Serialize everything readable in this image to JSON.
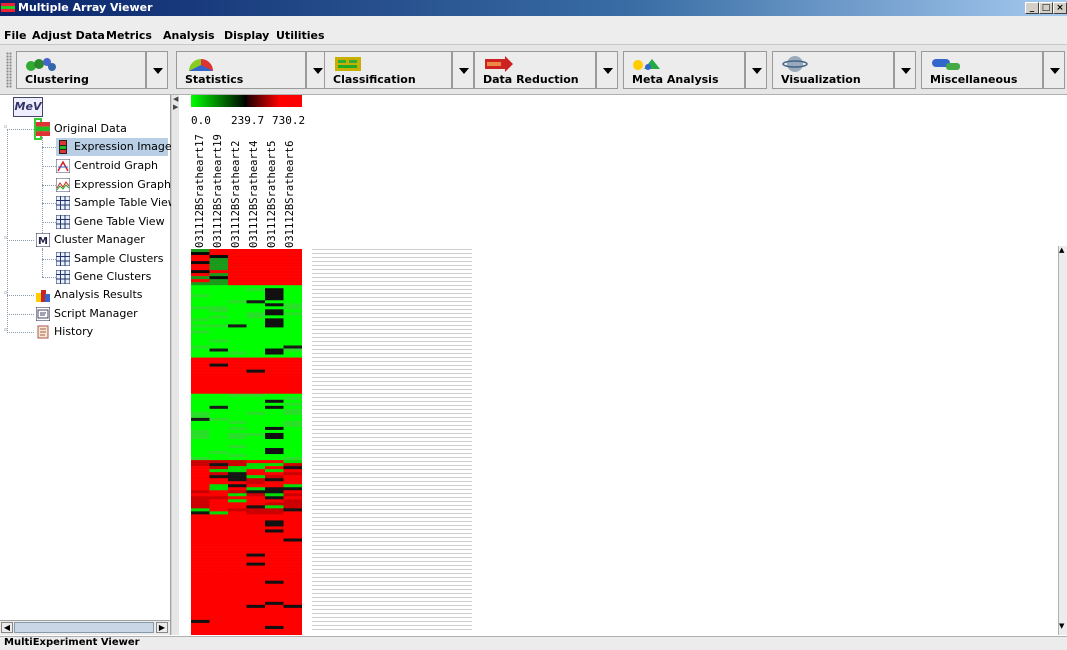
{
  "window": {
    "title": "Multiple Array Viewer"
  },
  "menu": [
    "File",
    "Adjust Data",
    "Metrics",
    "Analysis",
    "Display",
    "Utilities"
  ],
  "toolbar": [
    {
      "label": "Clustering",
      "icon": "clustering-icon"
    },
    {
      "label": "Statistics",
      "icon": "statistics-icon"
    },
    {
      "label": "Classification",
      "icon": "classification-icon"
    },
    {
      "label": "Data Reduction",
      "icon": "data-reduction-icon"
    },
    {
      "label": "Meta Analysis",
      "icon": "meta-analysis-icon"
    },
    {
      "label": "Visualization",
      "icon": "visualization-icon"
    },
    {
      "label": "Miscellaneous",
      "icon": "miscellaneous-icon"
    }
  ],
  "tree": {
    "logo": "MeV",
    "items": [
      {
        "label": "Original Data",
        "icon": "original-data-icon"
      },
      {
        "label": "Expression Image",
        "icon": "expression-image-icon"
      },
      {
        "label": "Centroid Graph",
        "icon": "centroid-graph-icon"
      },
      {
        "label": "Expression Graph",
        "icon": "expression-graph-icon"
      },
      {
        "label": "Sample Table View",
        "icon": "table-icon"
      },
      {
        "label": "Gene Table View",
        "icon": "table-icon"
      },
      {
        "label": "Cluster Manager",
        "icon": "cluster-manager-icon"
      },
      {
        "label": "Sample Clusters",
        "icon": "table-icon"
      },
      {
        "label": "Gene Clusters",
        "icon": "table-icon"
      },
      {
        "label": "Analysis Results",
        "icon": "analysis-results-icon"
      },
      {
        "label": "Script Manager",
        "icon": "script-manager-icon"
      },
      {
        "label": "History",
        "icon": "history-icon"
      }
    ]
  },
  "heatmap": {
    "scale": {
      "min": "0.0",
      "mid": "239.7",
      "max": "730.2"
    },
    "colors": {
      "low": "#00ff00",
      "mid": "#000000",
      "high": "#ff0000"
    },
    "samples": [
      "031112BSratheart17",
      "031112BSratheart19",
      "031112BSratheart2",
      "031112BSratheart4",
      "031112BSratheart5",
      "031112BSratheart6"
    ]
  },
  "status": "MultiExperiment Viewer"
}
